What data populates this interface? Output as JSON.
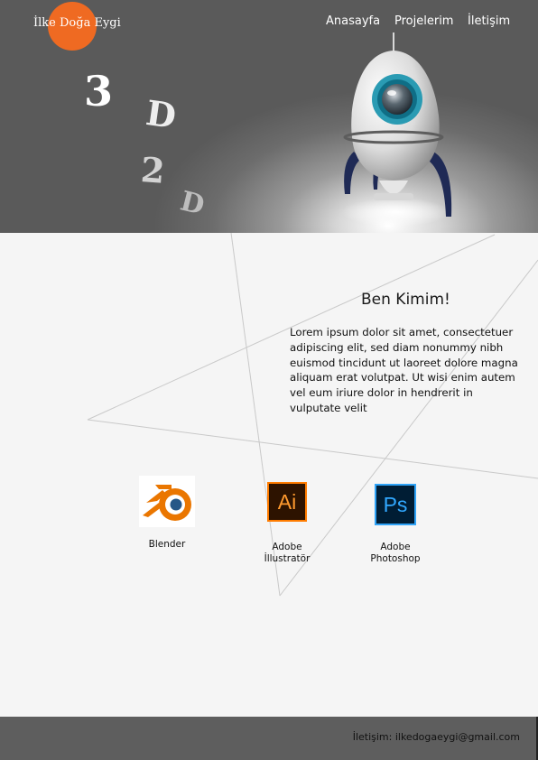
{
  "site": {
    "name": "İlke Doğa Eygi"
  },
  "nav": {
    "items": [
      "Anasayfa",
      "Projelerim",
      "İletişim"
    ]
  },
  "hero": {
    "decor": [
      "3",
      "D",
      "2",
      "D"
    ]
  },
  "about": {
    "title": "Ben Kimim!",
    "text": "Lorem ipsum dolor sit amet, consectetuer adipiscing elit, sed diam nonummy nibh euismod tincidunt ut laoreet dolore magna aliquam erat volutpat. Ut wisi enim autem vel eum iriure dolor in hendrerit in vulputate velit"
  },
  "tools": [
    {
      "label": "Blender",
      "icon": "blender-icon"
    },
    {
      "label": "Adobe\nİllustratör",
      "icon": "adobe-illustrator-icon",
      "icon_text": "Ai"
    },
    {
      "label": "Adobe\nPhotoshop",
      "icon": "adobe-photoshop-icon",
      "icon_text": "Ps"
    }
  ],
  "footer": {
    "contact": "İletişim: ilkedogaeygi@gmail.com"
  },
  "colors": {
    "accent": "#ef6a22",
    "header_bg": "#5a5a5a",
    "footer_bg": "#5e5e5e",
    "page_bg": "#f5f5f5"
  }
}
